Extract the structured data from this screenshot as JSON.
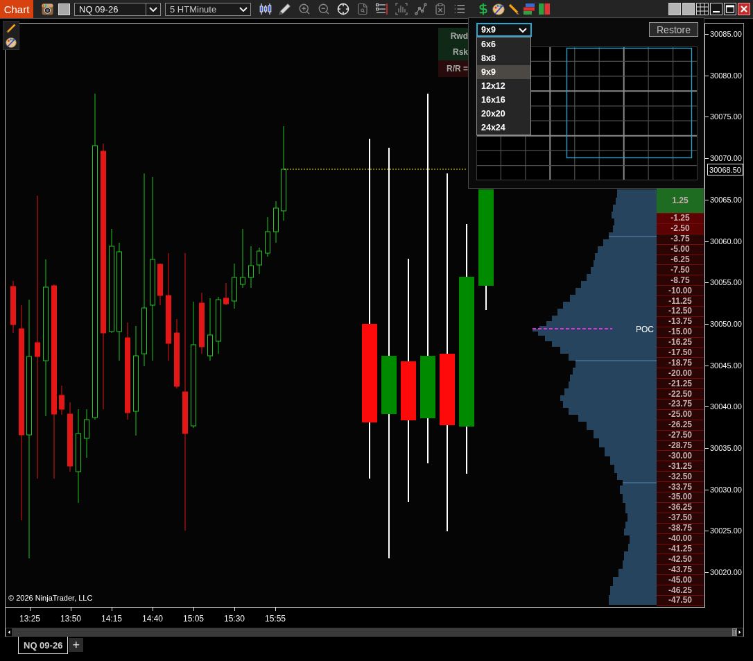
{
  "toolbar": {
    "title": "Chart",
    "instrument": "NQ 09-26",
    "timeframe": "5 HTMinute"
  },
  "risk_reward": [
    {
      "label": "Rwd",
      "color": "#0f2916"
    },
    {
      "label": "Rsk",
      "color": "#0f2916"
    },
    {
      "label": "R/R =",
      "color": "#2a0b0b"
    }
  ],
  "grid_popup": {
    "size_select": {
      "value": "9x9",
      "expanded": true
    },
    "options": [
      {
        "label": "6x6",
        "selected": false
      },
      {
        "label": "8x8",
        "selected": false
      },
      {
        "label": "9x9",
        "selected": true
      },
      {
        "label": "12x12",
        "selected": false
      },
      {
        "label": "16x16",
        "selected": false
      },
      {
        "label": "20x20",
        "selected": false
      },
      {
        "label": "24x24",
        "selected": false
      }
    ],
    "restore_button": "Restore"
  },
  "profile": {
    "poc_label": "POC"
  },
  "ladder": [
    {
      "value": "1.25",
      "color": "#1e6b22"
    },
    {
      "value": "-1.25",
      "color": "#5c0202"
    },
    {
      "value": "-2.50",
      "color": "#5c0202"
    },
    {
      "value": "-3.75",
      "color": "#2b0404"
    },
    {
      "value": "-5.00",
      "color": "#2b0404"
    },
    {
      "value": "-6.25",
      "color": "#2b0404"
    },
    {
      "value": "-7.50",
      "color": "#2b0404"
    },
    {
      "value": "-8.75",
      "color": "#2b0404"
    },
    {
      "value": "-10.00",
      "color": "#2b0404"
    },
    {
      "value": "-11.25",
      "color": "#2b0404"
    },
    {
      "value": "-12.50",
      "color": "#2b0404"
    },
    {
      "value": "-13.75",
      "color": "#2b0404"
    },
    {
      "value": "-15.00",
      "color": "#2b0404"
    },
    {
      "value": "-16.25",
      "color": "#2b0404"
    },
    {
      "value": "-17.50",
      "color": "#2b0404"
    },
    {
      "value": "-18.75",
      "color": "#2b0404"
    },
    {
      "value": "-20.00",
      "color": "#2b0404"
    },
    {
      "value": "-21.25",
      "color": "#2b0404"
    },
    {
      "value": "-22.50",
      "color": "#2b0404"
    },
    {
      "value": "-23.75",
      "color": "#2b0404"
    },
    {
      "value": "-25.00",
      "color": "#2b0404"
    },
    {
      "value": "-26.25",
      "color": "#2b0404"
    },
    {
      "value": "-27.50",
      "color": "#2b0404"
    },
    {
      "value": "-28.75",
      "color": "#2b0404"
    },
    {
      "value": "-30.00",
      "color": "#2b0404"
    },
    {
      "value": "-31.25",
      "color": "#2b0404"
    },
    {
      "value": "-32.50",
      "color": "#2b0404"
    },
    {
      "value": "-33.75",
      "color": "#2b0404"
    },
    {
      "value": "-35.00",
      "color": "#2b0404"
    },
    {
      "value": "-36.25",
      "color": "#2b0404"
    },
    {
      "value": "-37.50",
      "color": "#2b0404"
    },
    {
      "value": "-38.75",
      "color": "#2b0404"
    },
    {
      "value": "-40.00",
      "color": "#2b0404"
    },
    {
      "value": "-41.25",
      "color": "#2b0404"
    },
    {
      "value": "-42.50",
      "color": "#2b0404"
    },
    {
      "value": "-43.75",
      "color": "#2b0404"
    },
    {
      "value": "-45.00",
      "color": "#2b0404"
    },
    {
      "value": "-46.25",
      "color": "#2b0404"
    },
    {
      "value": "-47.50",
      "color": "#2b0404"
    }
  ],
  "price_axis": {
    "labels": [
      "30085.00",
      "30080.00",
      "30075.00",
      "30070.00",
      "30065.00",
      "30060.00",
      "30055.00",
      "30050.00",
      "30045.00",
      "30040.00",
      "30035.00",
      "30030.00",
      "30025.00",
      "30020.00"
    ],
    "current_price": "30068.50"
  },
  "copyright": "© 2026 NinjaTrader, LLC",
  "time_axis": [
    "13:25",
    "13:50",
    "14:15",
    "14:40",
    "15:05",
    "15:30",
    "15:55"
  ],
  "tabs": [
    {
      "label": "NQ 09-26",
      "selected": true
    }
  ],
  "add_tab": "+"
}
